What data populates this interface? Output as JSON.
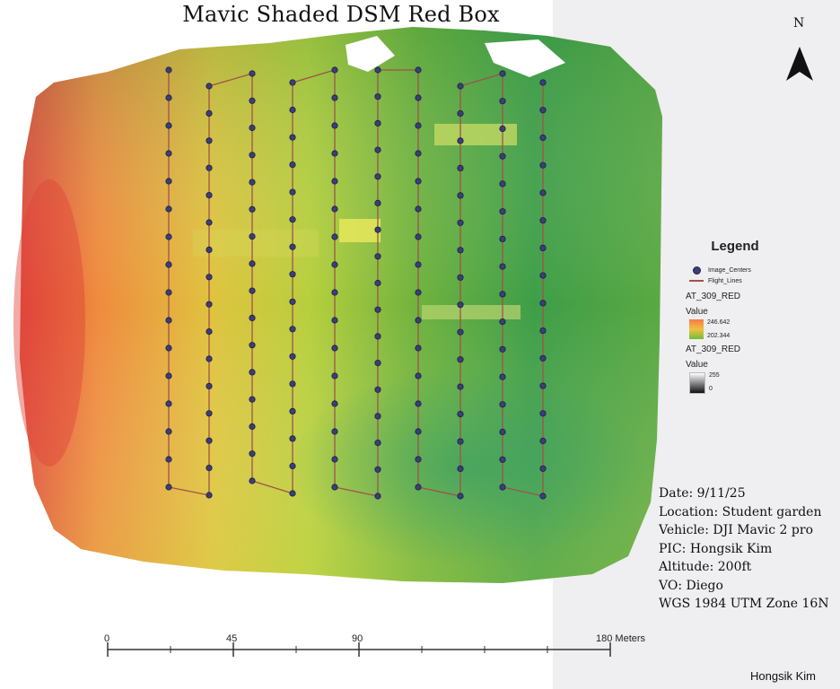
{
  "title": "Mavic Shaded DSM Red Box",
  "north": {
    "letter": "N",
    "icon": "north-arrow-icon"
  },
  "legend": {
    "title": "Legend",
    "items": [
      {
        "label": "Image_Centers",
        "icon": "point-symbol-icon"
      },
      {
        "label": "Flight_Lines",
        "icon": "line-symbol-icon"
      }
    ],
    "layers": [
      {
        "name": "AT_309_RED",
        "value_header": "Value",
        "high": "246.642",
        "low": "202.344",
        "ramp": [
          "#f57a4a",
          "#f0c040",
          "#6fbf3c"
        ]
      },
      {
        "name": "AT_309_RED",
        "value_header": "Value",
        "high": "255",
        "low": "0",
        "ramp": [
          "#ffffff",
          "#111111"
        ]
      }
    ]
  },
  "info": {
    "date": "Date: 9/11/25",
    "location": "Location: Student garden",
    "vehicle": "Vehicle: DJI Mavic 2 pro",
    "pic": "PIC: Hongsik Kim",
    "altitude": "Altitude: 200ft",
    "vo": "VO: Diego",
    "crs": "WGS 1984 UTM Zone 16N"
  },
  "scale_bar": {
    "labels": [
      "0",
      "45",
      "90",
      "180 Meters"
    ]
  },
  "author": "Hongsik Kim",
  "colors": {
    "flight_line": "#a0524a",
    "image_center": "#3b3f78",
    "dsm_high": "#e8453a",
    "dsm_mid": "#d8dc3c",
    "dsm_low": "#2f9a48"
  }
}
